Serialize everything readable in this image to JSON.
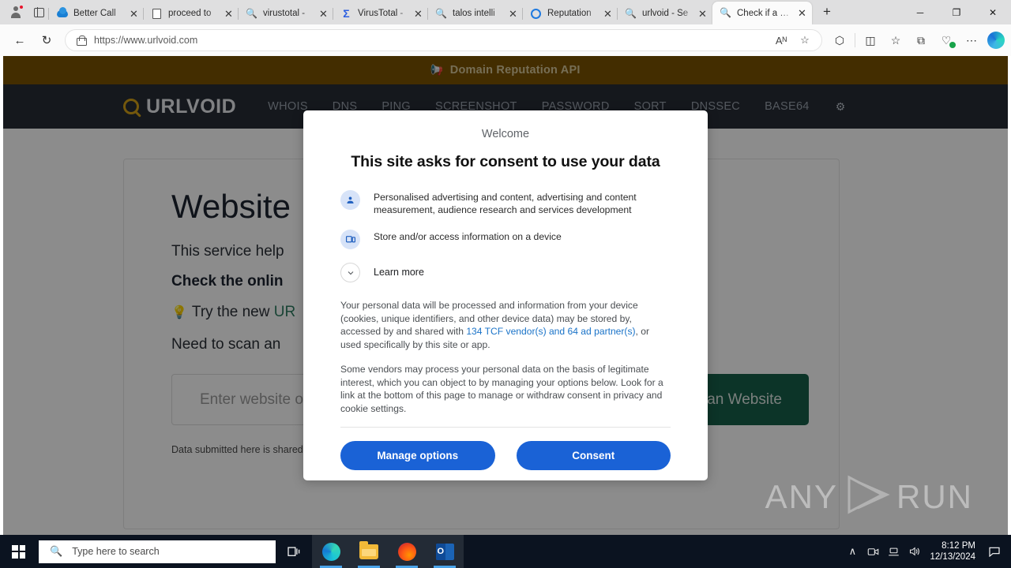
{
  "browser": {
    "tabs": [
      {
        "title": "Better Call",
        "favicon": "cloud-icon",
        "active": false
      },
      {
        "title": "proceed to",
        "favicon": "document-icon",
        "active": false
      },
      {
        "title": "virustotal -",
        "favicon": "search-icon",
        "active": false
      },
      {
        "title": "VirusTotal -",
        "favicon": "sigma-icon",
        "active": false
      },
      {
        "title": "talos intelli",
        "favicon": "search-icon",
        "active": false
      },
      {
        "title": "Reputation",
        "favicon": "circle-icon",
        "active": false
      },
      {
        "title": "urlvoid - Se",
        "favicon": "search-icon",
        "active": false
      },
      {
        "title": "Check if a …",
        "favicon": "urlvoid-icon",
        "active": true
      }
    ],
    "new_tab_label": "+",
    "close_label": "✕",
    "window_controls": {
      "minimize": "─",
      "maximize": "❐",
      "close": "✕"
    },
    "toolbar": {
      "back": "←",
      "reload": "↻",
      "url": "https://www.urlvoid.com",
      "read_aloud": "Aᴺ",
      "favorite": "☆",
      "extensions": "⬡",
      "split_screen": "◫",
      "collections_favorites": "☆",
      "add_collection": "⧉",
      "browser_essentials": "♡",
      "settings_more": "⋯",
      "copilot": "copilot-icon"
    }
  },
  "site": {
    "announcement": "Domain Reputation API",
    "announcement_icon": "megaphone-icon",
    "brand": "URLVOID",
    "nav_links": [
      "WHOIS",
      "DNS",
      "PING",
      "SCREENSHOT",
      "PASSWORD",
      "SORT",
      "DNSSEC",
      "BASE64"
    ],
    "nav_gear": "⚙",
    "heading": "Website",
    "lead": "This service help",
    "bold_line": "Check the onlin",
    "tip_prefix": "Try the new",
    "tip_link": "UR",
    "need_line": "Need to scan an",
    "input_placeholder": "Enter website or",
    "scan_button": "Scan Website",
    "fine_note": "Data submitted here is shared"
  },
  "watermark": {
    "left": "ANY",
    "right": "RUN"
  },
  "consent": {
    "eyebrow": "Welcome",
    "title": "This site asks for consent to use your data",
    "purposes": [
      {
        "icon": "person-icon",
        "text": "Personalised advertising and content, advertising and content measurement, audience research and services development"
      },
      {
        "icon": "device-icon",
        "text": "Store and/or access information on a device"
      }
    ],
    "learn_more": {
      "icon": "chevron-down-icon",
      "label": "Learn more"
    },
    "paragraph1_before": "Your personal data will be processed and information from your device (cookies, unique identifiers, and other device data) may be stored by, accessed by and shared with ",
    "paragraph1_link": "134 TCF vendor(s) and 64 ad partner(s)",
    "paragraph1_after": ", or used specifically by this site or app.",
    "paragraph2": "Some vendors may process your personal data on the basis of legitimate interest, which you can object to by managing your options below. Look for a link at the bottom of this page to manage or withdraw consent in privacy and cookie settings.",
    "manage_button": "Manage options",
    "consent_button": "Consent"
  },
  "taskbar": {
    "search_placeholder": "Type here to search",
    "search_icon": "magnifier-icon",
    "start_icon": "windows-logo",
    "task_view": "⧉",
    "apps": [
      {
        "name": "edge",
        "running": true
      },
      {
        "name": "file-explorer",
        "running": true
      },
      {
        "name": "firefox",
        "running": true
      },
      {
        "name": "outlook",
        "running": true
      }
    ],
    "tray": {
      "chevron": "∧",
      "meet_now": "◎",
      "network": "ᴗ",
      "volume": "🔊"
    },
    "time": "8:12 PM",
    "date": "12/13/2024",
    "notifications": "▭"
  },
  "colors": {
    "announcement_bg": "#7a5200",
    "nav_bg": "#272c35",
    "brand_gold": "#d4a017",
    "scan_green": "#16604a",
    "consent_blue": "#1a62d6",
    "link_blue": "#1a73c8"
  }
}
